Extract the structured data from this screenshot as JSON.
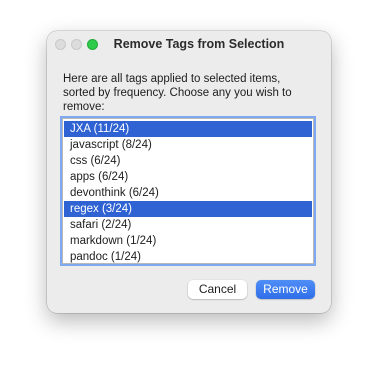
{
  "window": {
    "title": "Remove Tags from Selection"
  },
  "prompt": "Here are all tags applied to selected items, sorted by frequency. Choose any you wish to remove:",
  "tags": [
    {
      "label": "JXA (11/24)",
      "selected": true
    },
    {
      "label": "javascript (8/24)",
      "selected": false
    },
    {
      "label": "css (6/24)",
      "selected": false
    },
    {
      "label": "apps (6/24)",
      "selected": false
    },
    {
      "label": "devonthink (6/24)",
      "selected": false
    },
    {
      "label": "regex (3/24)",
      "selected": true
    },
    {
      "label": "safari (2/24)",
      "selected": false
    },
    {
      "label": "markdown (1/24)",
      "selected": false
    },
    {
      "label": "pandoc (1/24)",
      "selected": false
    }
  ],
  "buttons": {
    "cancel_label": "Cancel",
    "remove_label": "Remove"
  },
  "colors": {
    "selection": "#2f63d3",
    "default_button": "#2f6ee9",
    "focus_ring": "#7ea8ef"
  }
}
